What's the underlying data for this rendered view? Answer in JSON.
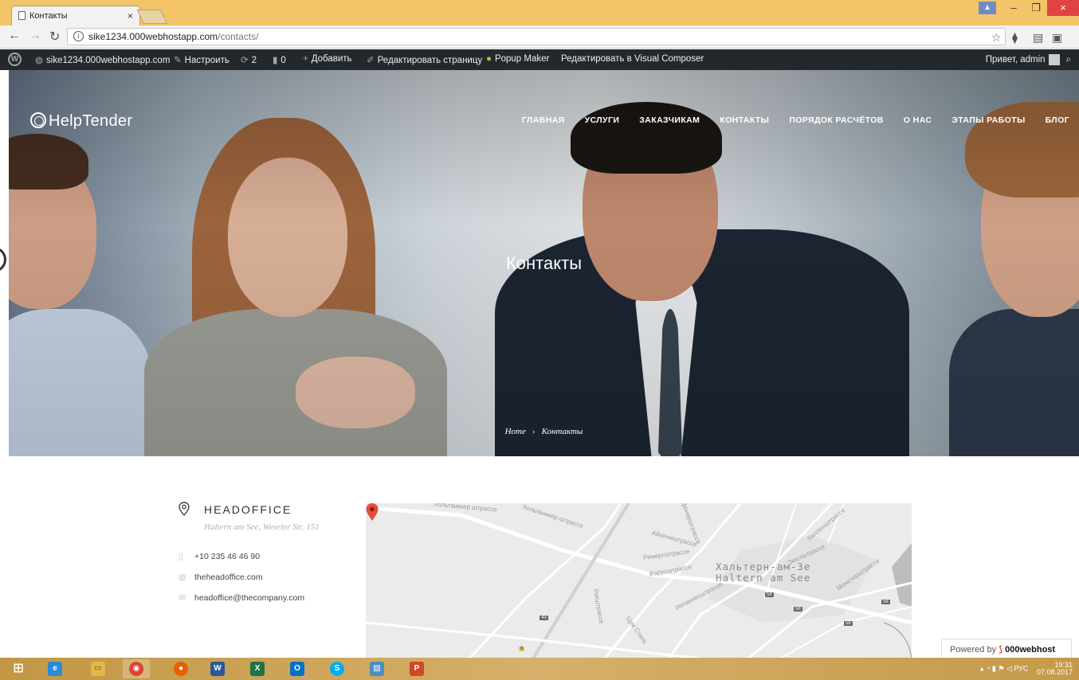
{
  "browser": {
    "tab_title": "Контакты",
    "tab_close": "×",
    "url_domain": "sike1234.000webhostapp.com",
    "url_path": "/contacts/",
    "window_controls": {
      "minimize": "–",
      "maximize": "❐",
      "close": "×"
    }
  },
  "adminbar": {
    "site": "sike1234.000webhostapp.com",
    "customize": "Настроить",
    "updates_count": "2",
    "comments_count": "0",
    "add_new": "Добавить",
    "edit_page": "Редактировать страницу",
    "popup_maker": "Popup Maker",
    "visual_composer": "Редактировать в Visual Composer",
    "greeting": "Привет, admin"
  },
  "site": {
    "logo": "HelpTender",
    "menu": [
      "ГЛАВНАЯ",
      "УСЛУГИ",
      "ЗАКАЗЧИКАМ",
      "КОНТАКТЫ",
      "ПОРЯДОК РАСЧЁТОВ",
      "О НАС",
      "ЭТАПЫ РАБОТЫ",
      "БЛОГ"
    ],
    "page_title": "Контакты",
    "breadcrumb": {
      "home": "Home",
      "separator": "›",
      "current": "Контакты"
    }
  },
  "contact": {
    "title": "HEADOFFICE",
    "address": "Haltern am See, Weseler Str. 151",
    "phone": "+10 235 46 46 90",
    "website": "theheadoffice.com",
    "email": "headoffice@thecompany.com"
  },
  "map": {
    "city_ru": "Хальтерн-ам-Зе",
    "city_de": "Haltern am See",
    "streets": [
      "Хольтвиккер штрассе",
      "Хольтвиккер штрассе",
      "Айхеништрассе",
      "Ремергштрассе",
      "Фарусштрассе",
      "Иоганнесштрассе",
      "Зюстштрассе",
      "Монстерштрассе",
      "Хелленштрассе",
      "Дюнерштрассе",
      "Ригштрассе",
      "Цум Стиль"
    ],
    "road_numbers": [
      "43",
      "58",
      "58",
      "58",
      "58",
      "8"
    ]
  },
  "powered_by": {
    "prefix": "Powered by",
    "brand": "000webhost"
  },
  "taskbar": {
    "tray_lang": "РУС",
    "time": "19:31",
    "date": "07.08.2017"
  },
  "colors": {
    "tabstrip": "#f3c568",
    "adminbar": "#23282d",
    "taskbar": "#c9a050",
    "map_marker": "#e74c3c"
  }
}
